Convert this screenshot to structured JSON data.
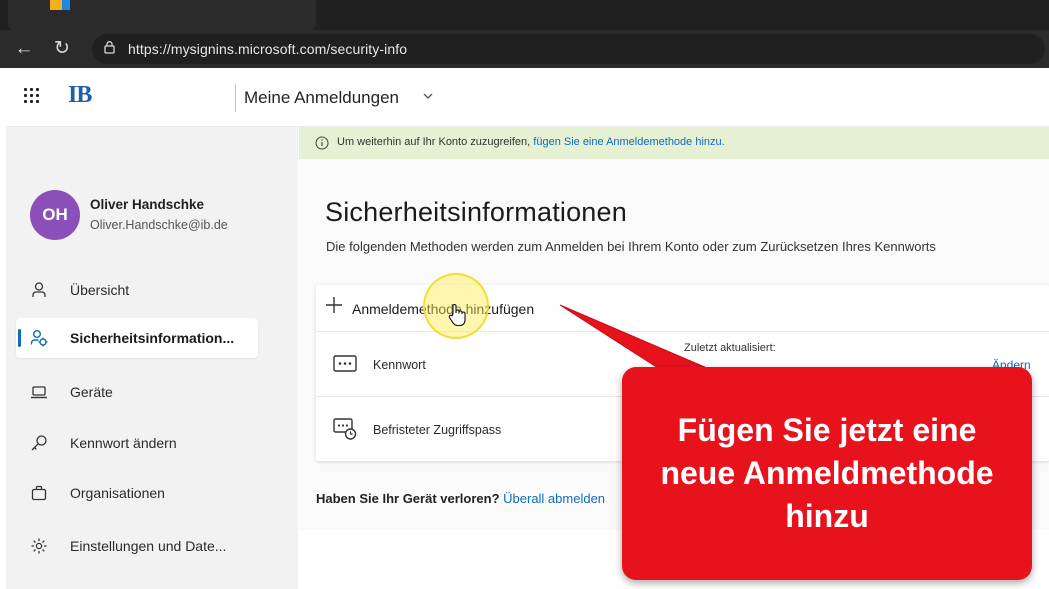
{
  "browser": {
    "url": "https://mysignins.microsoft.com/security-info"
  },
  "header": {
    "logo": "IB",
    "title": "Meine Anmeldungen"
  },
  "user": {
    "initials": "OH",
    "name": "Oliver Handschke",
    "email": "Oliver.Handschke@ib.de"
  },
  "sidebar": {
    "items": [
      {
        "label": "Übersicht",
        "icon": "person-icon"
      },
      {
        "label": "Sicherheitsinformation...",
        "icon": "security-person-icon",
        "active": true
      },
      {
        "label": "Geräte",
        "icon": "laptop-icon"
      },
      {
        "label": "Kennwort ändern",
        "icon": "key-icon"
      },
      {
        "label": "Organisationen",
        "icon": "briefcase-icon"
      },
      {
        "label": "Einstellungen und Date...",
        "icon": "settings-icon"
      }
    ]
  },
  "banner": {
    "text": "Um weiterhin auf Ihr Konto zuzugreifen,",
    "link": "fügen Sie eine Anmeldemethode hinzu."
  },
  "main": {
    "title": "Sicherheitsinformationen",
    "description": "Die folgenden Methoden werden zum Anmelden bei Ihrem Konto oder zum Zurücksetzen Ihres Kennworts",
    "add_method_label": "Anmeldemethode hinzufügen",
    "methods": [
      {
        "label": "Kennwort",
        "updated": "Zuletzt aktualisiert:",
        "action": "Ändern"
      },
      {
        "label": "Befristeter Zugriffspass"
      }
    ],
    "lost_device_question": "Haben Sie Ihr Gerät verloren?",
    "lost_device_link": "Überall abmelden"
  },
  "callout": {
    "line1": "Fügen Sie jetzt eine",
    "line2": "neue Anmeldmethode",
    "line3": "hinzu"
  },
  "colors": {
    "accent": "#0f6cbd",
    "callout": "#e8121d",
    "avatar": "#8a4fb8",
    "banner": "#e6f0d2"
  }
}
